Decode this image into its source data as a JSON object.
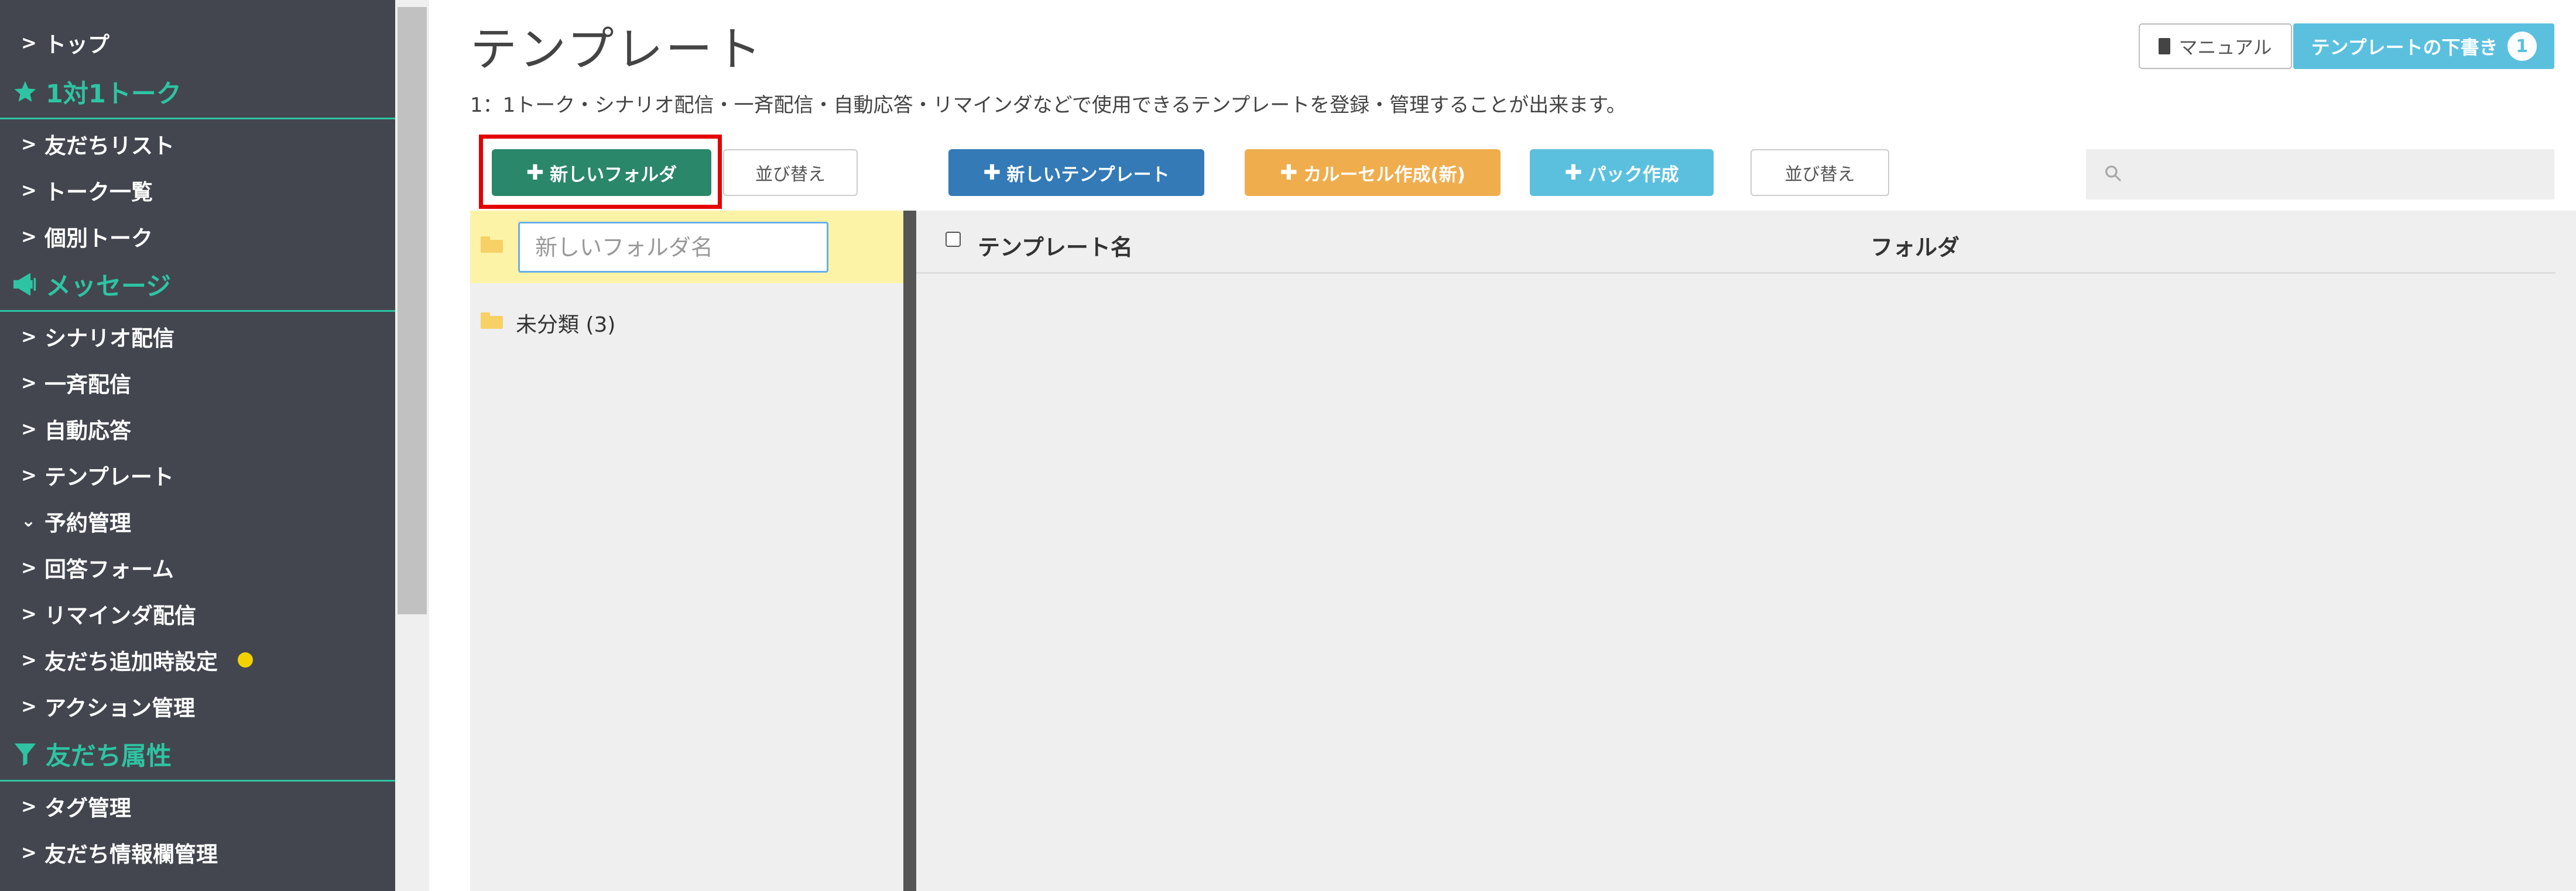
{
  "sidebar": {
    "items": [
      {
        "label": "トップ"
      },
      {
        "section": "1対1トーク"
      },
      {
        "label": "友だちリスト"
      },
      {
        "label": "トーク一覧"
      },
      {
        "label": "個別トーク"
      },
      {
        "section": "メッセージ"
      },
      {
        "label": "シナリオ配信"
      },
      {
        "label": "一斉配信"
      },
      {
        "label": "自動応答"
      },
      {
        "label": "テンプレート"
      },
      {
        "label": "予約管理"
      },
      {
        "label": "回答フォーム"
      },
      {
        "label": "リマインダ配信"
      },
      {
        "label": "友だち追加時設定"
      },
      {
        "label": "アクション管理"
      },
      {
        "section": "友だち属性"
      },
      {
        "label": "タグ管理"
      },
      {
        "label": "友だち情報欄管理"
      }
    ],
    "icons": {
      "star": "star-icon",
      "megaphone": "megaphone-icon",
      "filter": "filter-icon"
    },
    "colors": {
      "background": "#43464f",
      "accent": "#2ec4a3",
      "dot": "#f2d200"
    }
  },
  "header": {
    "title": "テンプレート",
    "description": "1：1トーク・シナリオ配信・一斉配信・自動応答・リマインダなどで使用できるテンプレートを登録・管理することが出来ます。",
    "manual_label": "マニュアル",
    "draft_label": "テンプレートの下書き",
    "draft_count": "1"
  },
  "toolbar": {
    "new_folder": "新しいフォルダ",
    "sort_left": "並び替え",
    "new_template": "新しいテンプレート",
    "carousel": "カルーセル作成(新)",
    "pack": "パック作成",
    "sort_right": "並び替え",
    "search_placeholder": ""
  },
  "folders": {
    "new_folder_placeholder": "新しいフォルダ名",
    "uncategorized_label": "未分類 (3)"
  },
  "table": {
    "columns": {
      "template_name": "テンプレート名",
      "folder": "フォルダ"
    }
  },
  "colors": {
    "new_folder": "#2b8769",
    "new_template": "#337ab7",
    "carousel": "#f0ad4e",
    "pack": "#5bc0de",
    "highlight": "#e40000",
    "selected_row": "#fdf3a6"
  }
}
